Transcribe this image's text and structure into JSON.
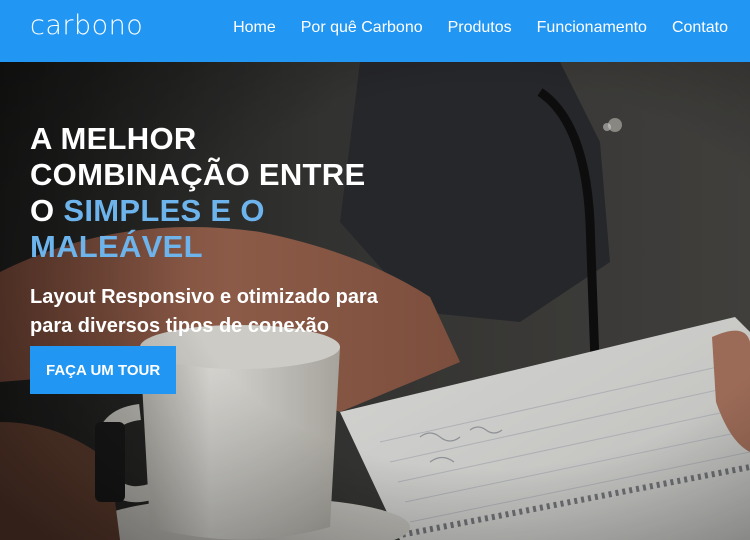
{
  "brand": {
    "logo": "carbono"
  },
  "nav": {
    "items": [
      {
        "label": "Home"
      },
      {
        "label": "Por quê Carbono"
      },
      {
        "label": "Produtos"
      },
      {
        "label": "Funcionamento"
      },
      {
        "label": "Contato"
      }
    ]
  },
  "hero": {
    "headline_part1": "A MELHOR COMBINAÇÃO ENTRE O",
    "headline_accent": "SIMPLES E O MALEÁVEL",
    "subheadline": "Layout Responsivo e otimizado para para diversos tipos de conexão",
    "cta_label": "FAÇA UM TOUR"
  },
  "colors": {
    "primary": "#2196f3",
    "accent_text": "#6db3ec",
    "text": "#ffffff"
  }
}
